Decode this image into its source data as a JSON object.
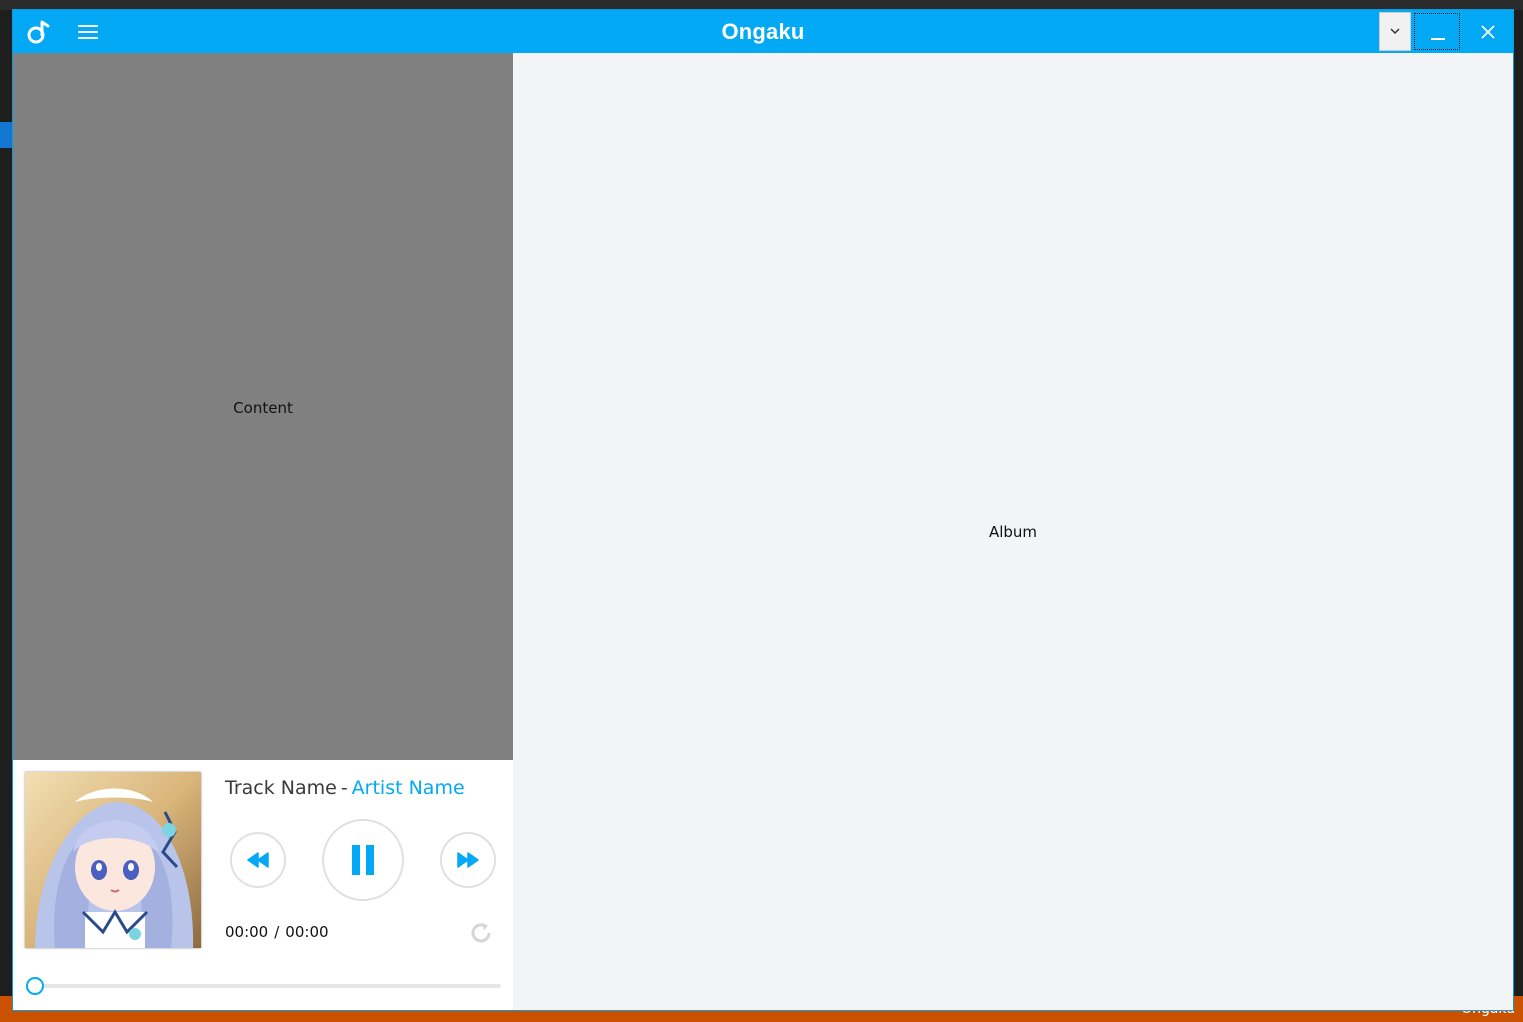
{
  "window": {
    "title": "Ongaku",
    "accent_color": "#03a9f4"
  },
  "content": {
    "label": "Content"
  },
  "album": {
    "label": "Album"
  },
  "player": {
    "track_name": "Track Name",
    "separator": "-",
    "artist_name": "Artist Name",
    "current_time": "00:00",
    "time_separator": "/",
    "total_time": "00:00",
    "progress": 0,
    "state": "playing"
  },
  "background": {
    "status_text": "Ongaku"
  },
  "icons": {
    "logo": "music-note-icon",
    "menu": "hamburger-icon",
    "dropdown": "chevron-down-icon",
    "minimize": "minimize-icon",
    "close": "close-icon",
    "previous": "rewind-icon",
    "pause": "pause-icon",
    "next": "fast-forward-icon",
    "repeat": "repeat-icon"
  }
}
